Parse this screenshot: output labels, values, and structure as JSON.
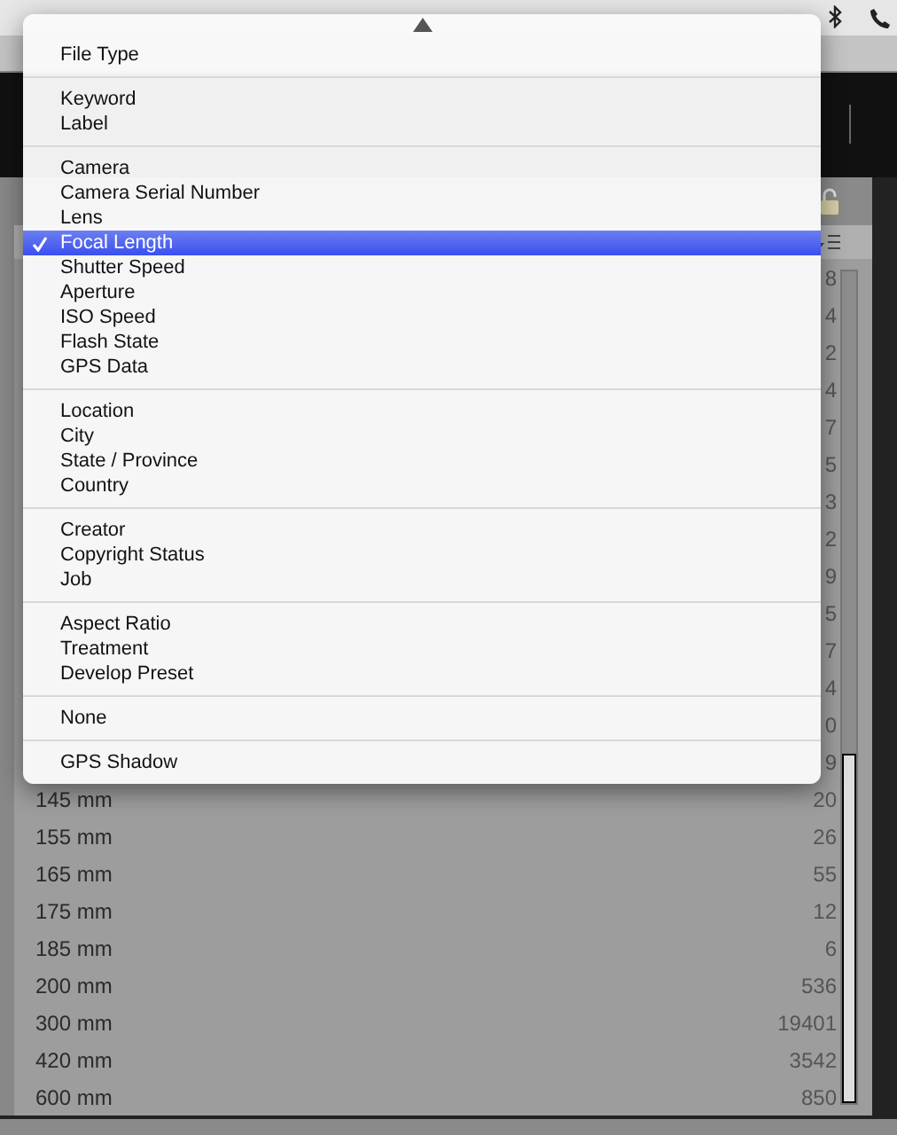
{
  "list": {
    "rows": [
      {
        "count": "8"
      },
      {
        "count": "4"
      },
      {
        "count": "2"
      },
      {
        "count": "4"
      },
      {
        "count": "7"
      },
      {
        "count": "5"
      },
      {
        "count": "3"
      },
      {
        "count": "2"
      },
      {
        "count": "9"
      },
      {
        "count": "5"
      },
      {
        "count": "7"
      },
      {
        "count": "4"
      },
      {
        "count": "0"
      },
      {
        "count": "9"
      },
      {
        "label": "145 mm",
        "count": "20"
      },
      {
        "label": "155 mm",
        "count": "26"
      },
      {
        "label": "165 mm",
        "count": "55"
      },
      {
        "label": "175 mm",
        "count": "12"
      },
      {
        "label": "185 mm",
        "count": "6"
      },
      {
        "label": "200 mm",
        "count": "536"
      },
      {
        "label": "300 mm",
        "count": "19401"
      },
      {
        "label": "420 mm",
        "count": "3542"
      },
      {
        "label": "600 mm",
        "count": "850"
      }
    ]
  },
  "menu": {
    "sections": [
      {
        "items": [
          {
            "label": "File Type",
            "selected": false
          }
        ]
      },
      {
        "items": [
          {
            "label": "Keyword",
            "selected": false
          },
          {
            "label": "Label",
            "selected": false
          }
        ]
      },
      {
        "items": [
          {
            "label": "Camera",
            "selected": false
          },
          {
            "label": "Camera Serial Number",
            "selected": false
          },
          {
            "label": "Lens",
            "selected": false
          },
          {
            "label": "Focal Length",
            "selected": true
          },
          {
            "label": "Shutter Speed",
            "selected": false
          },
          {
            "label": "Aperture",
            "selected": false
          },
          {
            "label": "ISO Speed",
            "selected": false
          },
          {
            "label": "Flash State",
            "selected": false
          },
          {
            "label": "GPS Data",
            "selected": false
          }
        ]
      },
      {
        "items": [
          {
            "label": "Location",
            "selected": false
          },
          {
            "label": "City",
            "selected": false
          },
          {
            "label": "State / Province",
            "selected": false
          },
          {
            "label": "Country",
            "selected": false
          }
        ]
      },
      {
        "items": [
          {
            "label": "Creator",
            "selected": false
          },
          {
            "label": "Copyright Status",
            "selected": false
          },
          {
            "label": "Job",
            "selected": false
          }
        ]
      },
      {
        "items": [
          {
            "label": "Aspect Ratio",
            "selected": false
          },
          {
            "label": "Treatment",
            "selected": false
          },
          {
            "label": "Develop Preset",
            "selected": false
          }
        ]
      },
      {
        "items": [
          {
            "label": "None",
            "selected": false
          }
        ]
      },
      {
        "items": [
          {
            "label": "GPS Shadow",
            "selected": false
          }
        ]
      }
    ]
  }
}
